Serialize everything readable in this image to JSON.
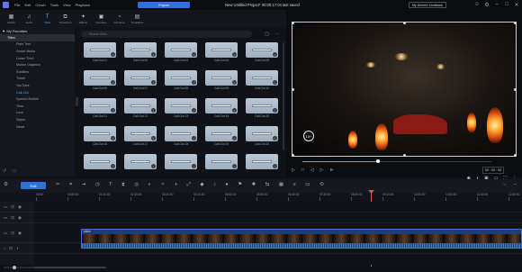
{
  "menu": [
    "File",
    "Edit",
    "GenAI",
    "Tools",
    "View",
    "Playback"
  ],
  "export_label": "Export",
  "project_title": "New Untitled Project* 00:00:17:04 last saved",
  "signin_label": "My DirectX Creations",
  "toolbar": [
    {
      "label": "Media",
      "icon": "film-icon"
    },
    {
      "label": "Audio",
      "icon": "music-icon"
    },
    {
      "label": "Titles",
      "icon": "text-icon",
      "active": true
    },
    {
      "label": "Transitions",
      "icon": "transition-icon"
    },
    {
      "label": "Effects",
      "icon": "effects-icon"
    },
    {
      "label": "Overlays",
      "icon": "overlays-icon"
    },
    {
      "label": "Animation",
      "icon": "animation-icon"
    },
    {
      "label": "Templates",
      "icon": "templates-icon"
    }
  ],
  "sidebar": {
    "header": "My Favorites",
    "items": [
      {
        "label": "Titles",
        "type": "group",
        "selected": true
      },
      {
        "label": "Plain Text"
      },
      {
        "label": "Social Media"
      },
      {
        "label": "Lower Third"
      },
      {
        "label": "Motion Graphics"
      },
      {
        "label": "Subtitles"
      },
      {
        "label": "Travel"
      },
      {
        "label": "YouTube"
      },
      {
        "label": "Call-Out",
        "highlight": true
      },
      {
        "label": "Speech Bubble"
      },
      {
        "label": "Time"
      },
      {
        "label": "Love"
      },
      {
        "label": "Styles"
      },
      {
        "label": "News"
      }
    ]
  },
  "search": {
    "placeholder": "Search titles"
  },
  "titles_grid": [
    "Call-Out 01",
    "Call-Out 02",
    "Call-Out 03",
    "Call-Out 04",
    "Call-Out 05",
    "Call-Out 06",
    "Call-Out 07",
    "Call-Out 08",
    "Call-Out 09",
    "Call-Out 10",
    "Call-Out 11",
    "Call-Out 12",
    "Call-Out 13",
    "Call-Out 14",
    "Call-Out 15",
    "Call-Out 16",
    "Call-Out 17",
    "Call-Out 18",
    "Call-Out 19",
    "Call-Out 20",
    "",
    "",
    "",
    "",
    ""
  ],
  "preview": {
    "rating_badge": "18+",
    "timecode": "00 : 00 : 05",
    "progress": 0.4
  },
  "timeline": {
    "edit_label": "Edit",
    "ruler": [
      "00:00",
      "00:50:00",
      "01:40:00",
      "02:30:00",
      "03:20:00",
      "04:10:00",
      "05:00:00",
      "05:50:00",
      "06:40:00",
      "07:30:00",
      "08:20:00",
      "09:10:00",
      "10:00:00",
      "10:50:00",
      "11:40:00",
      "12:30:00"
    ],
    "clip_name": "video"
  },
  "colors": {
    "accent": "#2f6fe0",
    "playhead": "#e5484d",
    "clip": "#1d3e70"
  }
}
